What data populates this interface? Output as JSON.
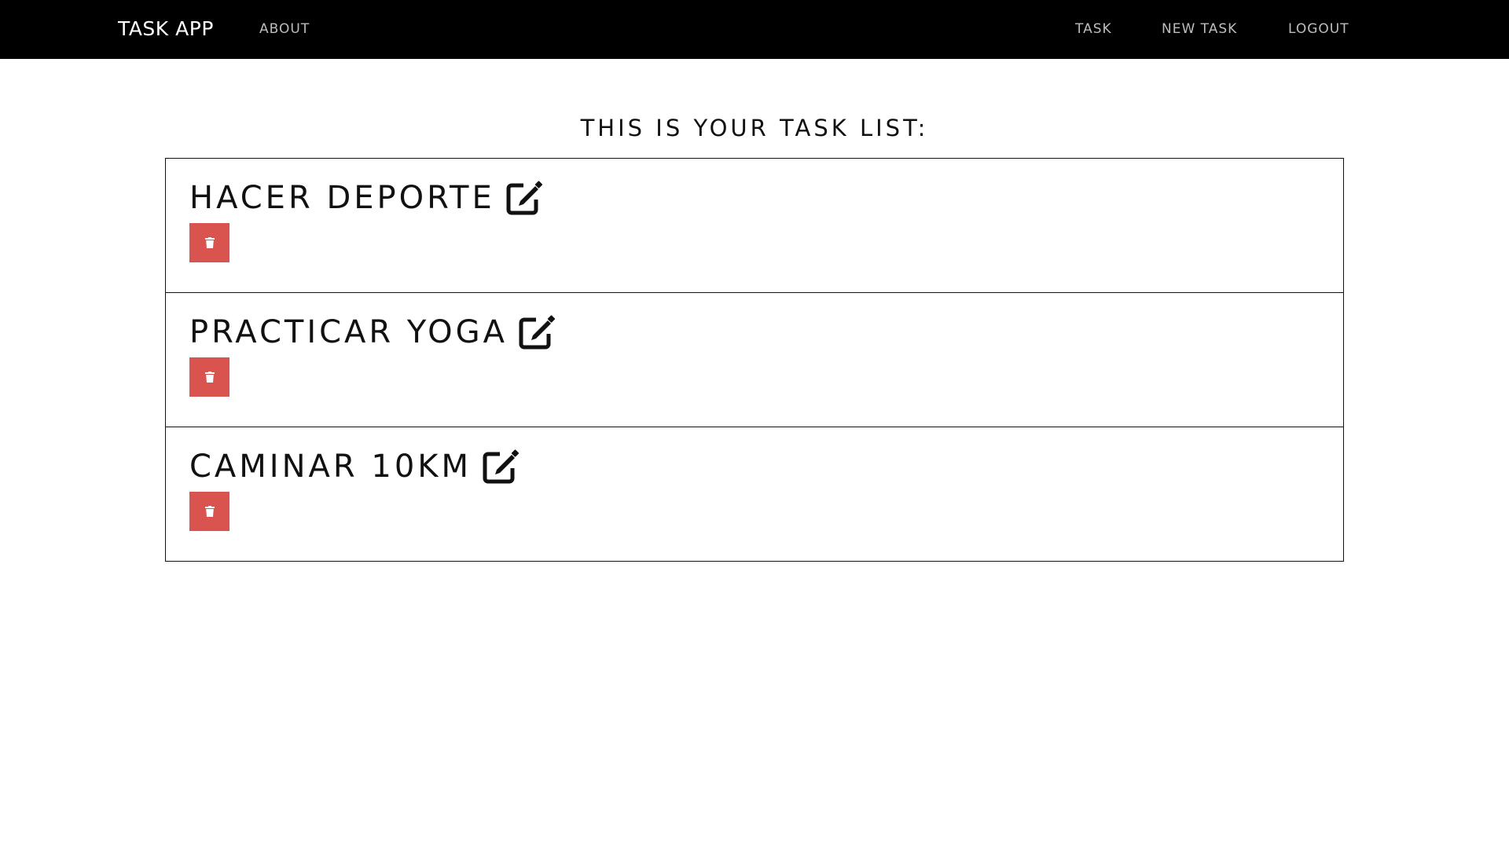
{
  "navbar": {
    "brand": "TASK APP",
    "about": "ABOUT",
    "task": "TASK",
    "new_task": "NEW TASK",
    "logout": "LOGOUT"
  },
  "main": {
    "title": "THIS IS YOUR TASK LIST:",
    "tasks": [
      {
        "name": "HACER DEPORTE",
        "edit_icon": "edit-icon",
        "delete_icon": "trash-icon"
      },
      {
        "name": "PRACTICAR YOGA",
        "edit_icon": "edit-icon",
        "delete_icon": "trash-icon"
      },
      {
        "name": "CAMINAR 10KM",
        "edit_icon": "edit-icon",
        "delete_icon": "trash-icon"
      }
    ]
  },
  "colors": {
    "navbar_bg": "#000000",
    "delete_button": "#d9534f",
    "text": "#111111"
  }
}
